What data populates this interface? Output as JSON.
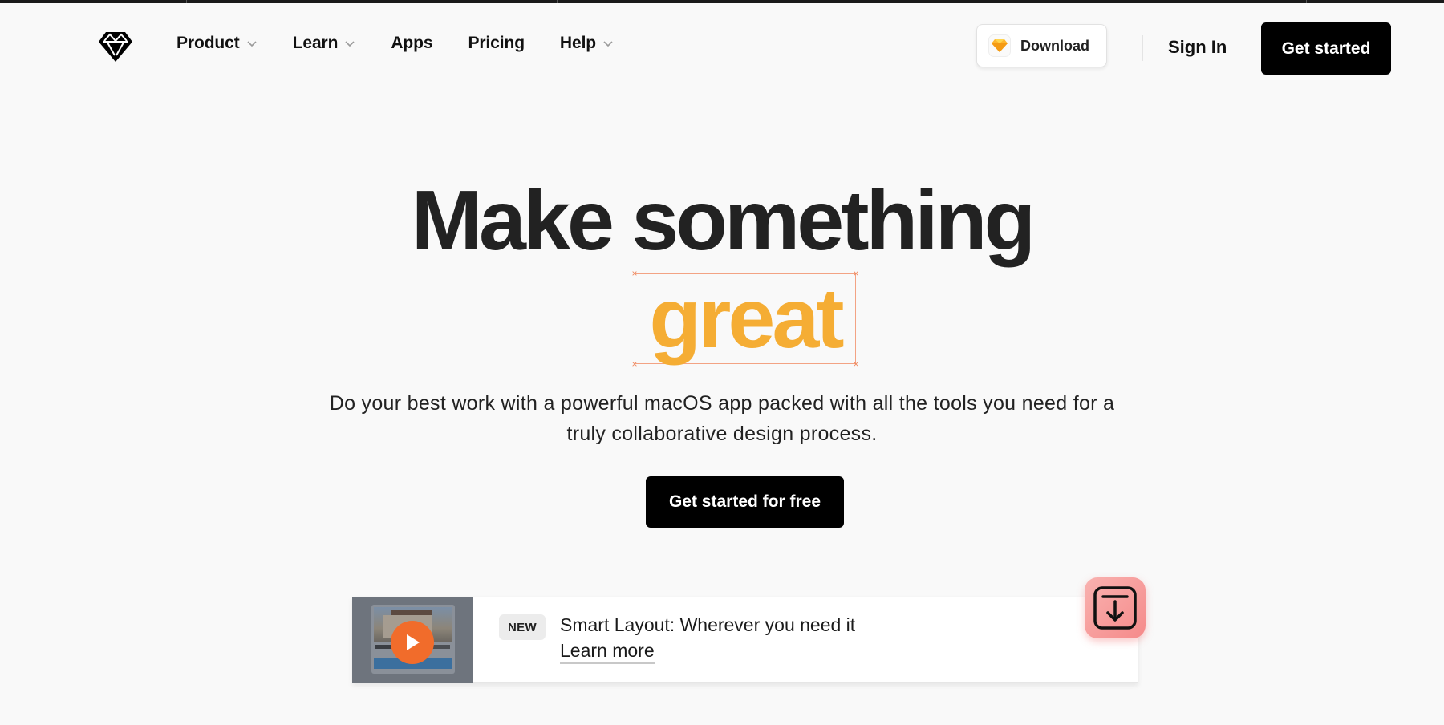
{
  "nav": {
    "logo": "sketch-diamond-logo",
    "items": [
      {
        "label": "Product",
        "has_dropdown": true
      },
      {
        "label": "Learn",
        "has_dropdown": true
      },
      {
        "label": "Apps",
        "has_dropdown": false
      },
      {
        "label": "Pricing",
        "has_dropdown": false
      },
      {
        "label": "Help",
        "has_dropdown": true
      }
    ],
    "download_label": "Download",
    "signin_label": "Sign In",
    "get_started_label": "Get started"
  },
  "hero": {
    "title_line1": "Make something",
    "title_highlight": "great",
    "subtitle": "Do your best work with a powerful macOS app packed with all the tools you need for a truly collaborative design process.",
    "cta_label": "Get started for free"
  },
  "banner": {
    "badge": "NEW",
    "title": "Smart Layout: Wherever you need it",
    "link_label": "Learn more"
  },
  "colors": {
    "accent": "#f5ad34",
    "highlight_box": "#f3a384",
    "play_button": "#f16c2b",
    "primary_button": "#000000",
    "background": "#f9f9f9"
  }
}
